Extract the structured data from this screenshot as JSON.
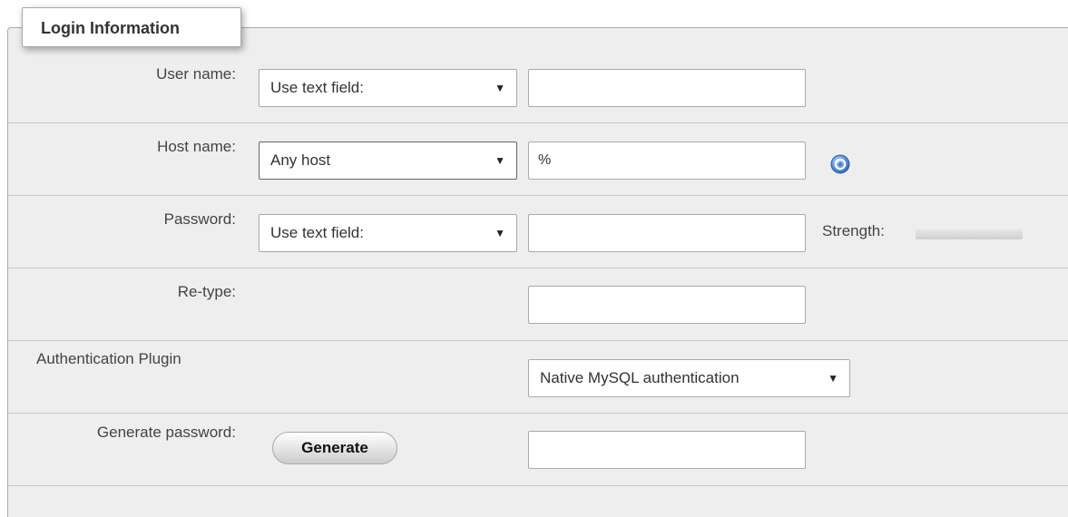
{
  "fieldset": {
    "legend": "Login Information"
  },
  "rows": {
    "user_name": {
      "label": "User name:",
      "select_value": "Use text field:",
      "input_value": ""
    },
    "host_name": {
      "label": "Host name:",
      "select_value": "Any host",
      "input_value": "%",
      "help_icon": "help-icon"
    },
    "password": {
      "label": "Password:",
      "select_value": "Use text field:",
      "input_value": "",
      "strength_label": "Strength:",
      "strength_level": 0
    },
    "retype": {
      "label": "Re-type:",
      "input_value": ""
    },
    "auth_plugin": {
      "label": "Authentication Plugin",
      "select_value": "Native MySQL authentication"
    },
    "generate_password": {
      "label": "Generate password:",
      "button_label": "Generate",
      "input_value": ""
    }
  },
  "colors": {
    "panel_background": "#eeeeee",
    "divider": "#c8c8c8",
    "help_icon": "#5b8fd8"
  },
  "arrow_glyph": "▼"
}
